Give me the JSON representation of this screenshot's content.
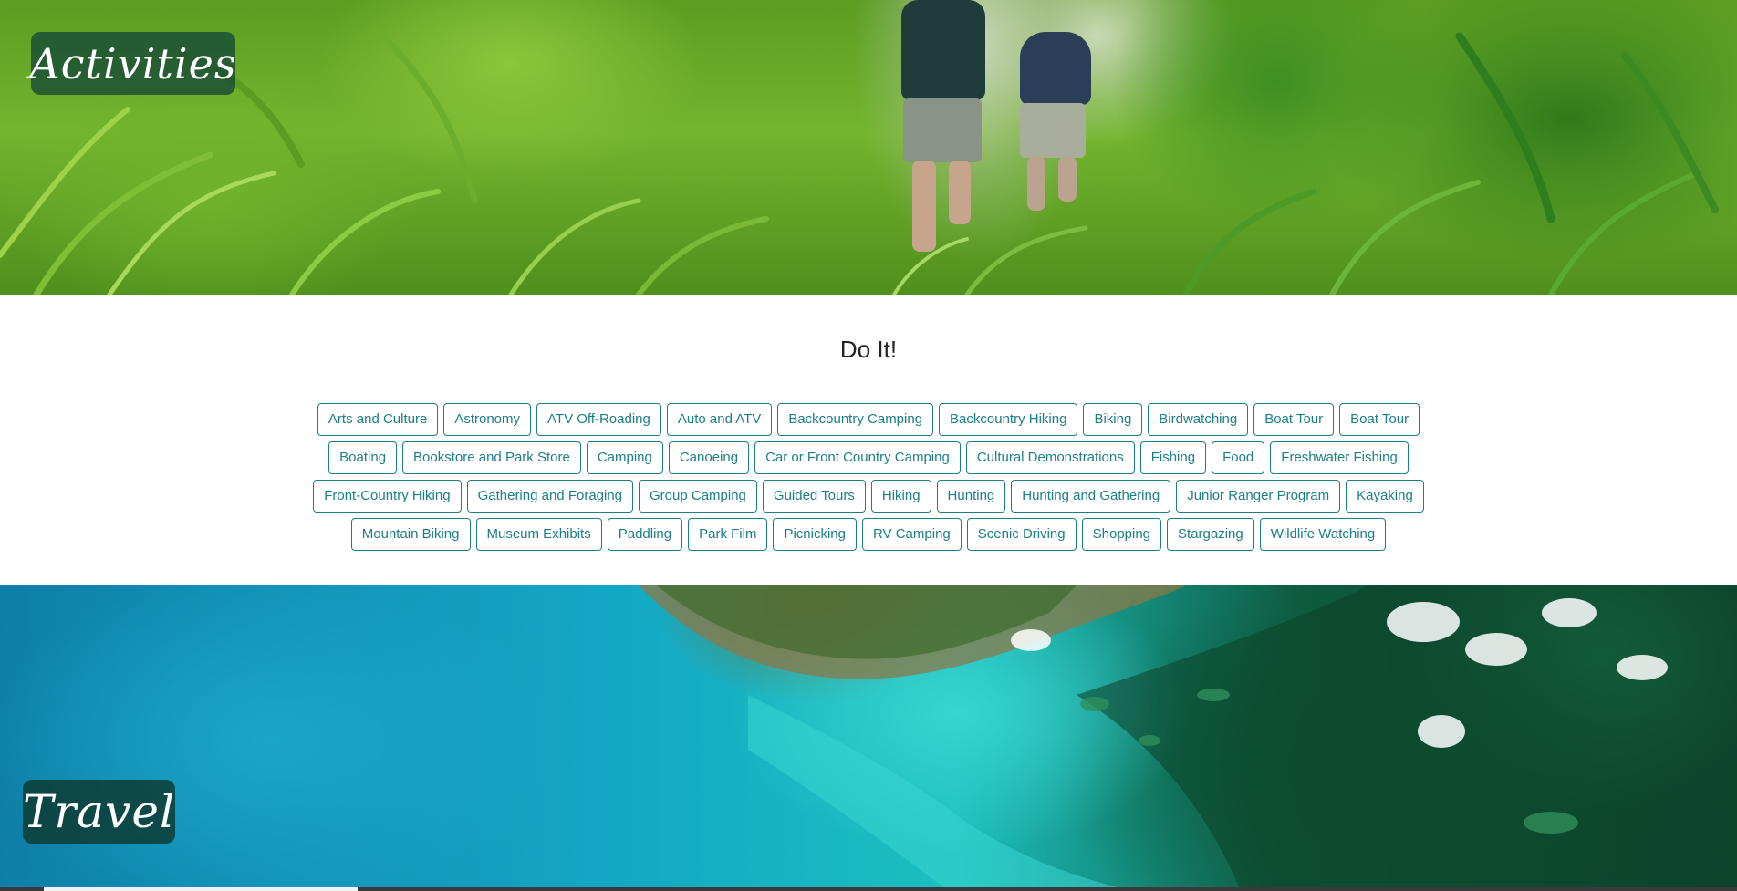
{
  "activities_section": {
    "title": "Activities"
  },
  "do_it_section": {
    "heading": "Do It!",
    "accent_color": "#1b7f86",
    "tags": [
      "Arts and Culture",
      "Astronomy",
      "ATV Off-Roading",
      "Auto and ATV",
      "Backcountry Camping",
      "Backcountry Hiking",
      "Biking",
      "Birdwatching",
      "Boat Tour",
      "Boat Tour",
      "Boating",
      "Bookstore and Park Store",
      "Camping",
      "Canoeing",
      "Car or Front Country Camping",
      "Cultural Demonstrations",
      "Fishing",
      "Food",
      "Freshwater Fishing",
      "Front-Country Hiking",
      "Gathering and Foraging",
      "Group Camping",
      "Guided Tours",
      "Hiking",
      "Hunting",
      "Hunting and Gathering",
      "Junior Ranger Program",
      "Kayaking",
      "Mountain Biking",
      "Museum Exhibits",
      "Paddling",
      "Park Film",
      "Picnicking",
      "RV Camping",
      "Scenic Driving",
      "Shopping",
      "Stargazing",
      "Wildlife Watching"
    ]
  },
  "travel_section": {
    "title": "Travel"
  }
}
